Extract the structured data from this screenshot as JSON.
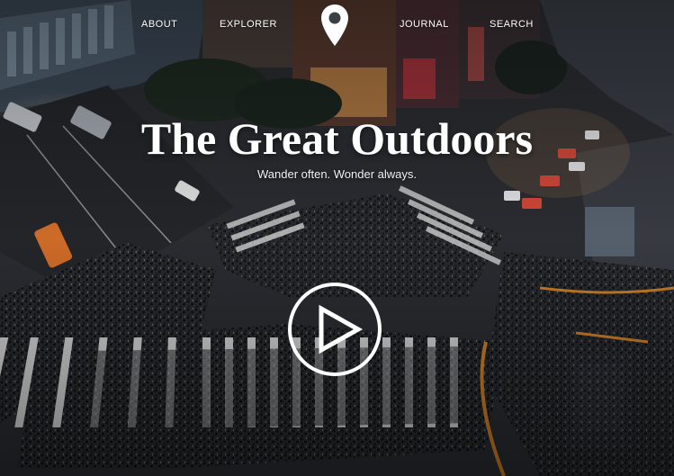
{
  "nav": {
    "items": [
      {
        "label": "ABOUT"
      },
      {
        "label": "EXPLORER"
      },
      {
        "label": "JOURNAL"
      },
      {
        "label": "SEARCH"
      }
    ],
    "logo_icon": "map-pin-icon"
  },
  "hero": {
    "title": "The Great Outdoors",
    "subtitle": "Wander often. Wonder always.",
    "play_icon": "play-icon",
    "background": "night city intersection photo"
  },
  "colors": {
    "text": "#ffffff",
    "overlay": "#1a1c20",
    "road": "#2b2d31",
    "crosswalk": "#e6e6e6",
    "accent_orange": "#d2822a"
  }
}
